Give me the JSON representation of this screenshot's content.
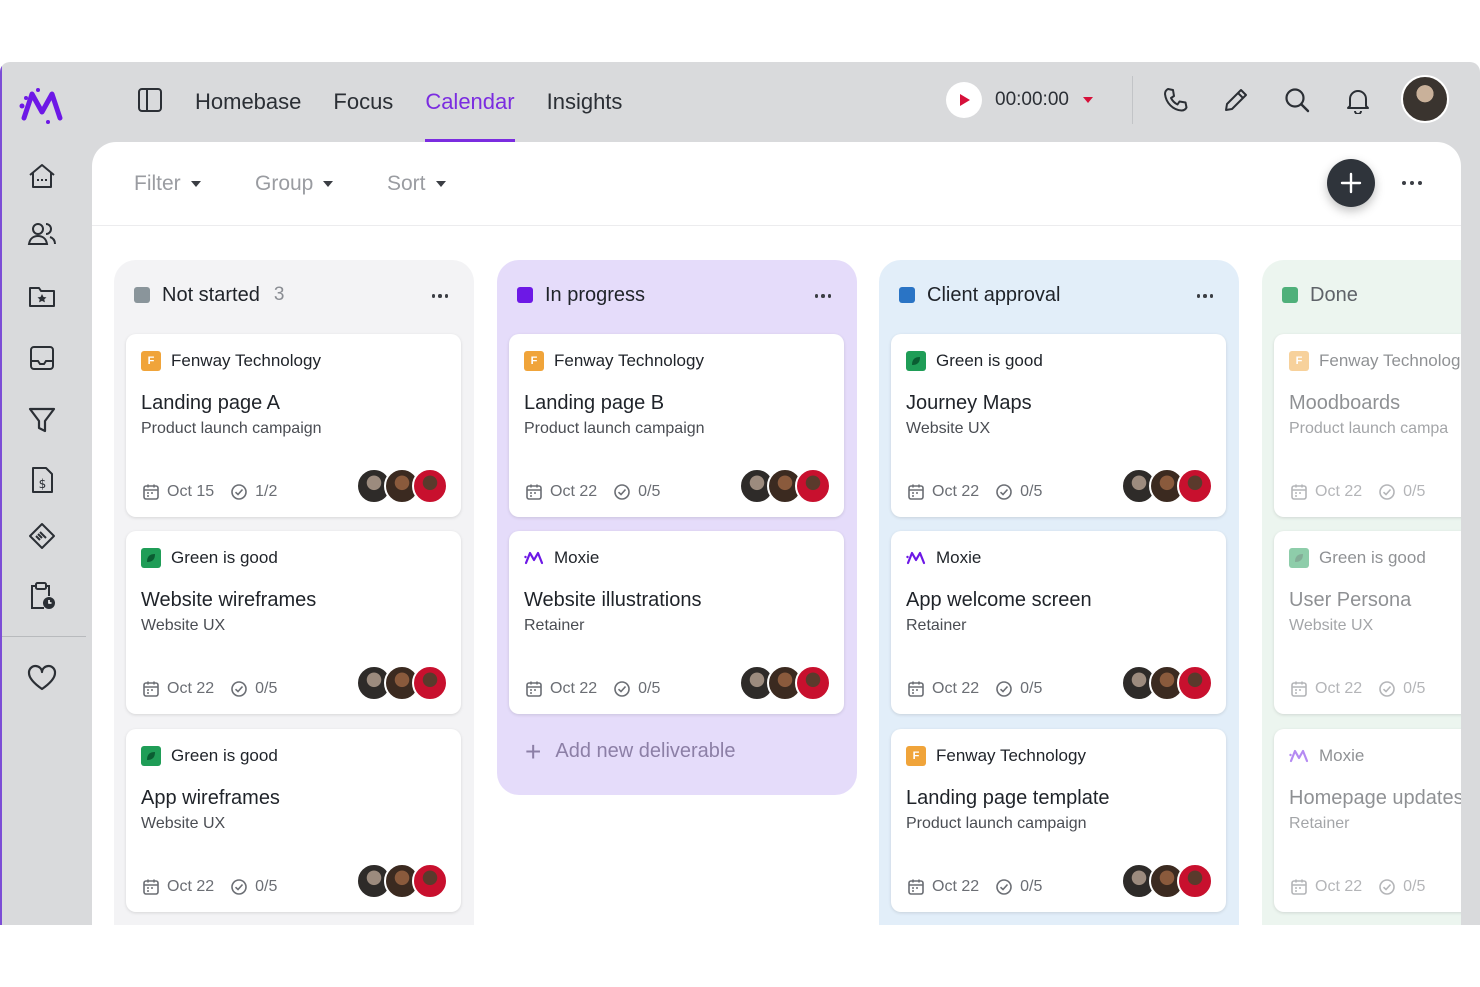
{
  "nav": {
    "tabs": [
      {
        "label": "Homebase"
      },
      {
        "label": "Focus"
      },
      {
        "label": "Calendar",
        "active": true
      },
      {
        "label": "Insights"
      }
    ]
  },
  "timer": {
    "value": "00:00:00"
  },
  "toolbar": {
    "filter": "Filter",
    "group": "Group",
    "sort": "Sort"
  },
  "columns": [
    {
      "name": "Not started",
      "count": "3",
      "color": "#8a959b",
      "cards": [
        {
          "client": "Fenway Technology",
          "badge": "F",
          "title": "Landing page A",
          "subtitle": "Product launch campaign",
          "date": "Oct 15",
          "tasks": "1/2"
        },
        {
          "client": "Green is good",
          "badge": "leaf",
          "title": "Website wireframes",
          "subtitle": "Website UX",
          "date": "Oct 22",
          "tasks": "0/5"
        },
        {
          "client": "Green is good",
          "badge": "leaf",
          "title": "App wireframes",
          "subtitle": "Website UX",
          "date": "Oct 22",
          "tasks": "0/5"
        }
      ]
    },
    {
      "name": "In progress",
      "count": "",
      "color": "#6d18e6",
      "cards": [
        {
          "client": "Fenway Technology",
          "badge": "F",
          "title": "Landing page B",
          "subtitle": "Product launch campaign",
          "date": "Oct 22",
          "tasks": "0/5"
        },
        {
          "client": "Moxie",
          "badge": "moxie",
          "title": "Website illustrations",
          "subtitle": "Retainer",
          "date": "Oct 22",
          "tasks": "0/5"
        }
      ],
      "add_label": "Add new deliverable"
    },
    {
      "name": "Client approval",
      "count": "",
      "color": "#2a74c5",
      "cards": [
        {
          "client": "Green is good",
          "badge": "leaf",
          "title": "Journey Maps",
          "subtitle": "Website UX",
          "date": "Oct 22",
          "tasks": "0/5"
        },
        {
          "client": "Moxie",
          "badge": "moxie",
          "title": "App welcome screen",
          "subtitle": "Retainer",
          "date": "Oct 22",
          "tasks": "0/5"
        },
        {
          "client": "Fenway Technology",
          "badge": "F",
          "title": "Landing page template",
          "subtitle": "Product launch campaign",
          "date": "Oct 22",
          "tasks": "0/5"
        }
      ]
    },
    {
      "name": "Done",
      "count": "",
      "color": "#4fb07a",
      "cards": [
        {
          "client": "Fenway Technolog",
          "badge": "F",
          "title": "Moodboards",
          "subtitle": "Product launch campa",
          "date": "Oct 22",
          "tasks": "0/5"
        },
        {
          "client": "Green is good",
          "badge": "leaf",
          "title": "User Persona",
          "subtitle": "Website UX",
          "date": "Oct 22",
          "tasks": "0/5"
        },
        {
          "client": "Moxie",
          "badge": "moxie",
          "title": "Homepage updates",
          "subtitle": "Retainer",
          "date": "Oct 22",
          "tasks": "0/5"
        }
      ]
    }
  ],
  "colors": {
    "accent": "#7b2ce0",
    "fenway": "#f0a43a",
    "green": "#1f9d57",
    "record": "#d6103a"
  },
  "icons": [
    "moxie-logo-icon",
    "panel-toggle-icon",
    "play-icon",
    "phone-icon",
    "pencil-icon",
    "search-icon",
    "bell-icon",
    "home-icon",
    "users-icon",
    "folder-star-icon",
    "inbox-icon",
    "funnel-icon",
    "invoice-icon",
    "handshake-icon",
    "clipboard-clock-icon",
    "heart-icon",
    "plus-icon",
    "more-icon",
    "calendar-icon",
    "check-circle-icon"
  ]
}
